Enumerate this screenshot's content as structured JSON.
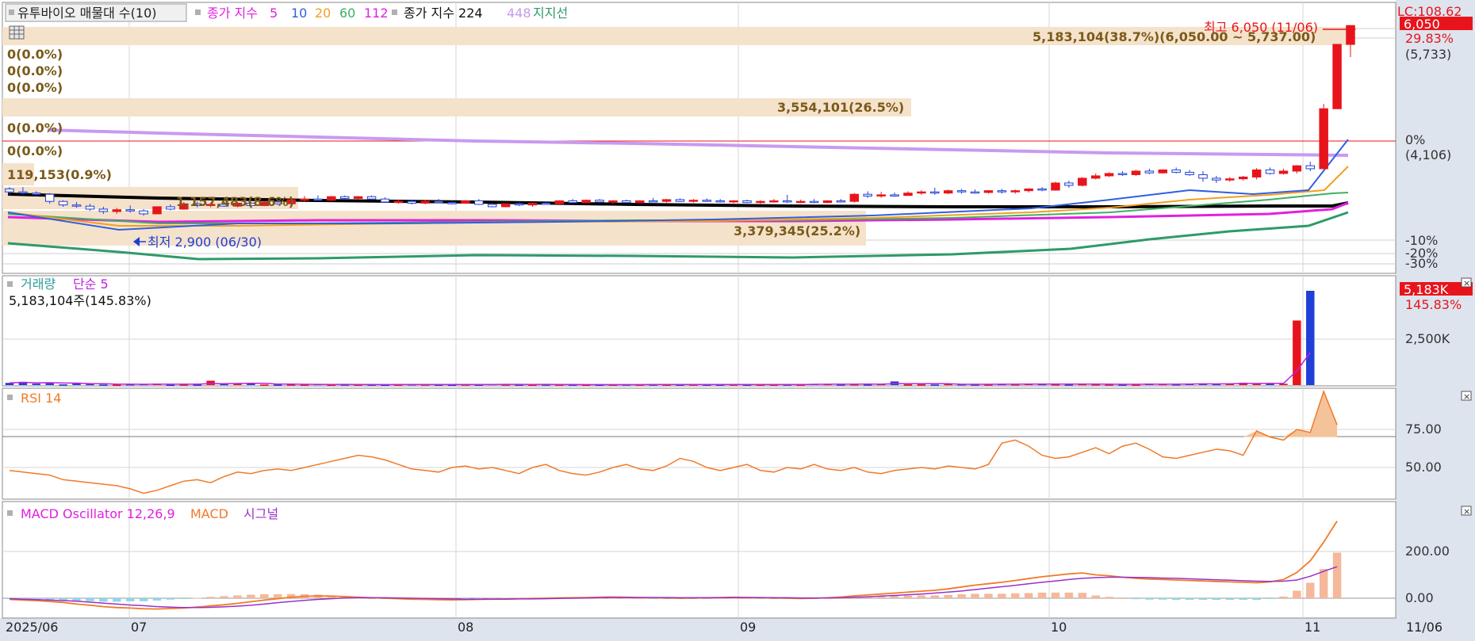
{
  "main_legend": {
    "title": "유투바이오 매물대 수(10)",
    "ma_label": "종가 지수",
    "ma_periods": [
      "5",
      "10",
      "20",
      "60",
      "112"
    ],
    "ma_long_label": "종가 지수 224",
    "ma_long2": "448",
    "support_label": "지지선"
  },
  "price_axis": {
    "lc_label": "LC:108.62",
    "current_price": "6,050",
    "pct_top": "29.83%",
    "price_top": "(5,733)",
    "pct_zero": "0%",
    "price_zero": "(4,106)",
    "pct_m10": "-10%",
    "pct_m20": "-20%",
    "pct_m30": "-30%"
  },
  "annotations": {
    "high": "최고 6,050 (11/06)",
    "low": "최저 2,900 (06/30)"
  },
  "volume_profile": [
    "5,183,104(38.7%)(6,050.00 ~ 5,737.00)",
    "0(0.0%)",
    "0(0.0%)",
    "0(0.0%)",
    "3,554,101(26.5%)",
    "0(0.0%)",
    "0(0.0%)",
    "119,153(0.9%)",
    "1,157,483(8.6%)",
    "3,379,345(25.2%)"
  ],
  "volume_panel": {
    "legend_1": "거래량",
    "legend_2": "단순 5",
    "info": "5,183,104주(145.83%)",
    "current": "5,183K",
    "pct": "145.83%",
    "tick_mid": "2,500K"
  },
  "rsi_panel": {
    "legend": "RSI 14",
    "tick_75": "75.00",
    "tick_50": "50.00"
  },
  "macd_panel": {
    "legend_1": "MACD Oscillator 12,26,9",
    "legend_2": "MACD",
    "legend_3": "시그널",
    "tick_200": "200.00",
    "tick_0": "0.00"
  },
  "x_axis": {
    "labels": [
      "2025/06",
      "07",
      "08",
      "09",
      "10",
      "11"
    ],
    "right_label": "11/06"
  },
  "colors": {
    "up": "#e8141c",
    "down": "#1f3fd6",
    "rsi": "#f07a28",
    "macd": "#f07a28",
    "signal": "#9b30c8",
    "volume_ma": "#c020e0",
    "profile": "#f5e2cb",
    "profile_text": "#7a5a1a",
    "axis_bg": "#dde4ee"
  },
  "chart_data": {
    "type": "candlestick",
    "start_date": "2025-06-23",
    "ohlc": [
      [
        3300,
        3330,
        3180,
        3250
      ],
      [
        3250,
        3330,
        3200,
        3230
      ],
      [
        3230,
        3260,
        3180,
        3210
      ],
      [
        3210,
        3230,
        3050,
        3090
      ],
      [
        3090,
        3110,
        3000,
        3030
      ],
      [
        3030,
        3080,
        2980,
        3010
      ],
      [
        3010,
        3050,
        2930,
        2960
      ],
      [
        2960,
        3000,
        2880,
        2920
      ],
      [
        2920,
        2980,
        2880,
        2950
      ],
      [
        2950,
        3020,
        2900,
        2930
      ],
      [
        2930,
        2960,
        2850,
        2880
      ],
      [
        2880,
        2970,
        2900,
        3000
      ],
      [
        3000,
        3040,
        2940,
        2960
      ],
      [
        2960,
        3080,
        2950,
        3050
      ],
      [
        3050,
        3090,
        2990,
        3020
      ],
      [
        3020,
        3070,
        2990,
        3040
      ],
      [
        3040,
        3100,
        3000,
        3010
      ],
      [
        3010,
        3080,
        2990,
        3060
      ],
      [
        3060,
        3080,
        3000,
        3020
      ],
      [
        3020,
        3090,
        3010,
        3080
      ],
      [
        3080,
        3110,
        3030,
        3050
      ],
      [
        3050,
        3140,
        3050,
        3120
      ],
      [
        3120,
        3180,
        3080,
        3130
      ],
      [
        3130,
        3190,
        3100,
        3110
      ],
      [
        3110,
        3180,
        3100,
        3170
      ],
      [
        3170,
        3190,
        3120,
        3140
      ],
      [
        3140,
        3180,
        3120,
        3170
      ],
      [
        3170,
        3190,
        3110,
        3130
      ],
      [
        3130,
        3160,
        3070,
        3080
      ],
      [
        3080,
        3120,
        3050,
        3090
      ],
      [
        3090,
        3110,
        3040,
        3060
      ],
      [
        3060,
        3110,
        3040,
        3090
      ],
      [
        3090,
        3130,
        3060,
        3070
      ],
      [
        3070,
        3100,
        3040,
        3060
      ],
      [
        3060,
        3110,
        3050,
        3100
      ],
      [
        3100,
        3130,
        3030,
        3040
      ],
      [
        3040,
        3070,
        2990,
        3000
      ],
      [
        3000,
        3060,
        2990,
        3050
      ],
      [
        3050,
        3080,
        3010,
        3030
      ],
      [
        3030,
        3070,
        3000,
        3060
      ],
      [
        3060,
        3080,
        3040,
        3050
      ],
      [
        3050,
        3110,
        3040,
        3100
      ],
      [
        3100,
        3130,
        3060,
        3070
      ],
      [
        3070,
        3120,
        3060,
        3110
      ],
      [
        3110,
        3130,
        3060,
        3080
      ],
      [
        3080,
        3110,
        3050,
        3100
      ],
      [
        3100,
        3120,
        3060,
        3070
      ],
      [
        3070,
        3110,
        3060,
        3100
      ],
      [
        3100,
        3150,
        3080,
        3090
      ],
      [
        3090,
        3130,
        3070,
        3120
      ],
      [
        3120,
        3140,
        3080,
        3090
      ],
      [
        3090,
        3130,
        3070,
        3110
      ],
      [
        3110,
        3140,
        3080,
        3100
      ],
      [
        3100,
        3130,
        3070,
        3080
      ],
      [
        3080,
        3110,
        3060,
        3100
      ],
      [
        3100,
        3120,
        3060,
        3070
      ],
      [
        3070,
        3110,
        3050,
        3090
      ],
      [
        3090,
        3130,
        3070,
        3100
      ],
      [
        3100,
        3200,
        3060,
        3080
      ],
      [
        3080,
        3120,
        3060,
        3090
      ],
      [
        3090,
        3130,
        3060,
        3070
      ],
      [
        3070,
        3110,
        3060,
        3100
      ],
      [
        3100,
        3130,
        3070,
        3090
      ],
      [
        3090,
        3230,
        3070,
        3210
      ],
      [
        3210,
        3260,
        3150,
        3180
      ],
      [
        3180,
        3250,
        3150,
        3200
      ],
      [
        3200,
        3240,
        3170,
        3190
      ],
      [
        3190,
        3260,
        3190,
        3230
      ],
      [
        3230,
        3280,
        3200,
        3250
      ],
      [
        3250,
        3320,
        3200,
        3230
      ],
      [
        3230,
        3290,
        3210,
        3270
      ],
      [
        3270,
        3300,
        3220,
        3250
      ],
      [
        3250,
        3290,
        3220,
        3240
      ],
      [
        3240,
        3280,
        3220,
        3270
      ],
      [
        3270,
        3300,
        3220,
        3250
      ],
      [
        3250,
        3290,
        3220,
        3270
      ],
      [
        3270,
        3310,
        3240,
        3300
      ],
      [
        3300,
        3330,
        3260,
        3280
      ],
      [
        3280,
        3420,
        3270,
        3400
      ],
      [
        3400,
        3440,
        3320,
        3360
      ],
      [
        3360,
        3500,
        3340,
        3480
      ],
      [
        3480,
        3560,
        3460,
        3520
      ],
      [
        3520,
        3580,
        3500,
        3560
      ],
      [
        3560,
        3600,
        3520,
        3540
      ],
      [
        3540,
        3620,
        3520,
        3600
      ],
      [
        3600,
        3640,
        3550,
        3570
      ],
      [
        3570,
        3630,
        3560,
        3620
      ],
      [
        3620,
        3660,
        3560,
        3580
      ],
      [
        3580,
        3620,
        3520,
        3540
      ],
      [
        3540,
        3600,
        3420,
        3480
      ],
      [
        3480,
        3520,
        3400,
        3450
      ],
      [
        3450,
        3500,
        3420,
        3470
      ],
      [
        3470,
        3520,
        3440,
        3500
      ],
      [
        3500,
        3650,
        3460,
        3620
      ],
      [
        3620,
        3660,
        3540,
        3560
      ],
      [
        3560,
        3640,
        3540,
        3600
      ],
      [
        3600,
        3700,
        3560,
        3690
      ],
      [
        3690,
        3760,
        3600,
        3640
      ],
      [
        3640,
        4730,
        3640,
        4650
      ],
      [
        4650,
        5733,
        4650,
        5733
      ],
      [
        5733,
        6050,
        5520,
        6050
      ]
    ],
    "volume_k": [
      120,
      180,
      80,
      150,
      40,
      90,
      60,
      30,
      20,
      50,
      60,
      80,
      20,
      40,
      30,
      240,
      60,
      70,
      90,
      30,
      30,
      40,
      30,
      60,
      20,
      40,
      30,
      30,
      20,
      30,
      50,
      40,
      30,
      20,
      40,
      30,
      60,
      40,
      30,
      20,
      40,
      30,
      30,
      20,
      20,
      30,
      40,
      30,
      40,
      30,
      30,
      40,
      30,
      30,
      40,
      30,
      30,
      30,
      40,
      30,
      70,
      60,
      40,
      50,
      40,
      60,
      200,
      40,
      40,
      30,
      60,
      50,
      40,
      40,
      60,
      50,
      70,
      60,
      50,
      40,
      60,
      50,
      40,
      30,
      30,
      80,
      60,
      50,
      70,
      80,
      60,
      90,
      130,
      80,
      90,
      70,
      3550,
      5183
    ],
    "rsi": [
      48,
      47,
      46,
      45,
      42,
      41,
      40,
      39,
      38,
      36,
      33,
      35,
      38,
      41,
      42,
      40,
      44,
      47,
      46,
      48,
      49,
      48,
      50,
      52,
      54,
      56,
      58,
      57,
      55,
      52,
      49,
      48,
      47,
      50,
      51,
      49,
      50,
      48,
      46,
      50,
      52,
      48,
      46,
      45,
      47,
      50,
      52,
      49,
      48,
      51,
      56,
      54,
      50,
      48,
      50,
      52,
      48,
      47,
      50,
      49,
      52,
      49,
      48,
      50,
      47,
      46,
      48,
      49,
      50,
      49,
      51,
      50,
      49,
      52,
      66,
      68,
      64,
      58,
      56,
      57,
      60,
      63,
      59,
      64,
      66,
      62,
      57,
      56,
      58,
      60,
      62,
      61,
      58,
      74,
      70,
      68,
      75,
      73,
      100,
      78
    ],
    "macd": [
      -5,
      -8,
      -10,
      -14,
      -18,
      -25,
      -30,
      -36,
      -40,
      -42,
      -45,
      -46,
      -44,
      -42,
      -38,
      -33,
      -28,
      -22,
      -15,
      -8,
      -2,
      4,
      8,
      10,
      9,
      7,
      4,
      2,
      0,
      -2,
      -4,
      -5,
      -6,
      -7,
      -6,
      -5,
      -4,
      -3,
      -2,
      -1,
      0,
      1,
      2,
      3,
      4,
      5,
      4,
      3,
      2,
      1,
      0,
      1,
      2,
      3,
      4,
      3,
      2,
      1,
      0,
      -1,
      0,
      2,
      5,
      10,
      14,
      18,
      22,
      26,
      30,
      34,
      40,
      48,
      56,
      62,
      68,
      76,
      84,
      92,
      98,
      104,
      108,
      100,
      96,
      90,
      85,
      82,
      80,
      78,
      76,
      74,
      72,
      70,
      68,
      66,
      70,
      80,
      110,
      160,
      240,
      330
    ],
    "signal": [
      -2,
      -4,
      -6,
      -8,
      -10,
      -13,
      -17,
      -21,
      -25,
      -29,
      -32,
      -36,
      -38,
      -40,
      -40,
      -39,
      -37,
      -34,
      -30,
      -25,
      -19,
      -14,
      -9,
      -5,
      -2,
      1,
      2,
      2,
      2,
      1,
      0,
      -1,
      -2,
      -3,
      -4,
      -4,
      -4,
      -4,
      -3,
      -3,
      -2,
      -1,
      0,
      1,
      2,
      3,
      3,
      3,
      3,
      3,
      2,
      2,
      2,
      2,
      3,
      3,
      3,
      2,
      2,
      1,
      1,
      1,
      2,
      4,
      6,
      9,
      12,
      15,
      18,
      22,
      26,
      31,
      37,
      43,
      49,
      55,
      62,
      68,
      74,
      80,
      85,
      88,
      90,
      90,
      89,
      88,
      86,
      85,
      83,
      81,
      79,
      77,
      75,
      73,
      72,
      73,
      78,
      94,
      115,
      135
    ]
  }
}
